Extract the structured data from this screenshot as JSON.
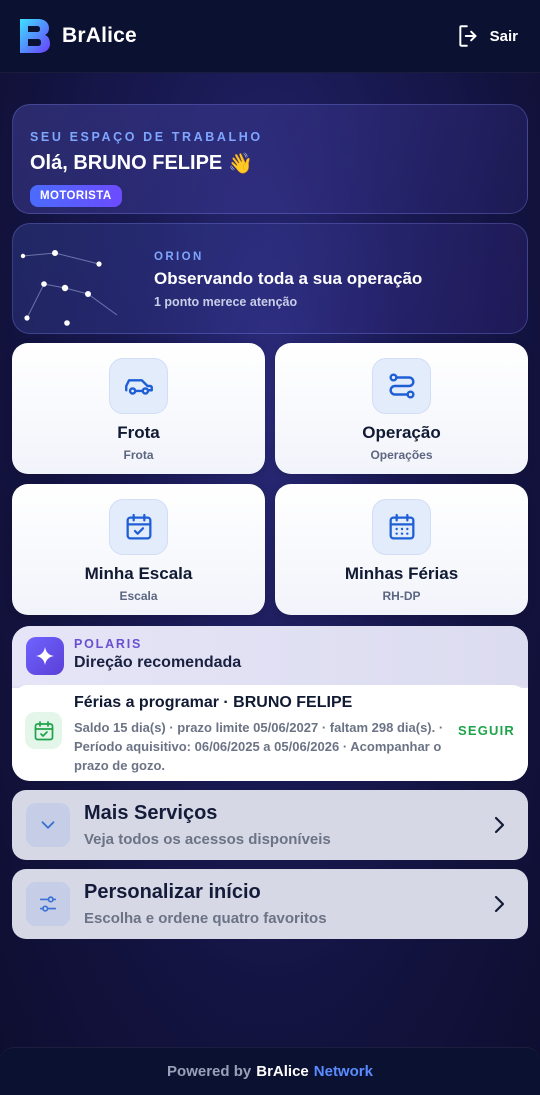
{
  "header": {
    "app_name": "BrAlice",
    "logout_label": "Sair",
    "logo_icon": "bralice-logo",
    "logout_icon": "logout-icon"
  },
  "workspace": {
    "eyebrow": "SEU ESPAÇO DE TRABALHO",
    "greeting": "Olá, BRUNO FELIPE",
    "greeting_emoji": "👋",
    "role": "MOTORISTA"
  },
  "orion": {
    "eyebrow": "ORION",
    "title": "Observando toda a sua operação",
    "subtitle": "1 ponto merece atenção"
  },
  "tiles": [
    {
      "title": "Frota",
      "subtitle": "Frota",
      "icon": "car-icon"
    },
    {
      "title": "Operação",
      "subtitle": "Operações",
      "icon": "route-icon"
    },
    {
      "title": "Minha Escala",
      "subtitle": "Escala",
      "icon": "calendar-check-icon"
    },
    {
      "title": "Minhas Férias",
      "subtitle": "RH-DP",
      "icon": "calendar-grid-icon"
    }
  ],
  "polaris": {
    "eyebrow": "POLARIS",
    "title": "Direção recomendada",
    "recommendation": {
      "title": "Férias a programar · BRUNO FELIPE",
      "detail": "Saldo 15 dia(s) · prazo limite 05/06/2027 · faltam 298 dia(s). · Período aquisitivo: 06/06/2025 a 05/06/2026 · Acompanhar o prazo de gozo.",
      "action": "SEGUIR"
    }
  },
  "more_services": {
    "title": "Mais Serviços",
    "subtitle": "Veja todos os acessos disponíveis"
  },
  "customize": {
    "title": "Personalizar início",
    "subtitle": "Escolha e ordene quatro favoritos"
  },
  "footer": {
    "powered": "Powered by",
    "brand": "BrAlice",
    "network": "Network"
  },
  "colors": {
    "accent": "#4b6bff",
    "success": "#1fa34a",
    "polaris": "#6a4fd0"
  }
}
